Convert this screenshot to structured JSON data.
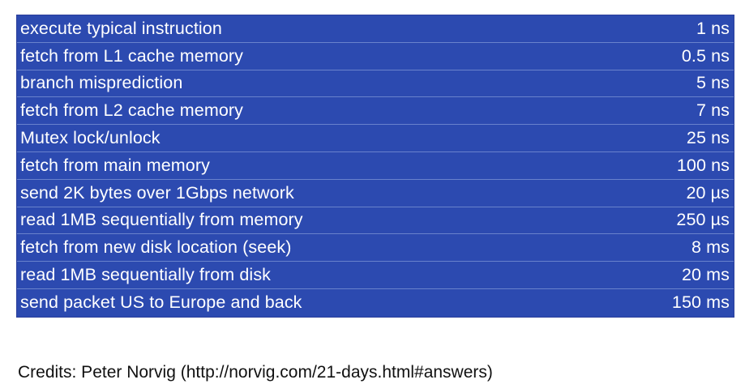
{
  "table": {
    "rows": [
      {
        "label": "execute typical instruction",
        "value": "1 ns"
      },
      {
        "label": "fetch from L1 cache memory",
        "value": "0.5 ns"
      },
      {
        "label": "branch misprediction",
        "value": "5 ns"
      },
      {
        "label": "fetch from L2 cache memory",
        "value": "7 ns"
      },
      {
        "label": "Mutex lock/unlock",
        "value": "25 ns"
      },
      {
        "label": "fetch from main memory",
        "value": "100 ns"
      },
      {
        "label": "send 2K bytes over 1Gbps network",
        "value": "20 µs"
      },
      {
        "label": "read 1MB sequentially from memory",
        "value": "250 µs"
      },
      {
        "label": "fetch from new disk location (seek)",
        "value": "8 ms"
      },
      {
        "label": "read 1MB sequentially from disk",
        "value": "20 ms"
      },
      {
        "label": "send packet US to Europe and back",
        "value": "150 ms"
      }
    ],
    "colors": {
      "background": "#2c4ab0",
      "text": "#ffffff"
    }
  },
  "credits": "Credits: Peter Norvig (http://norvig.com/21-days.html#answers)"
}
